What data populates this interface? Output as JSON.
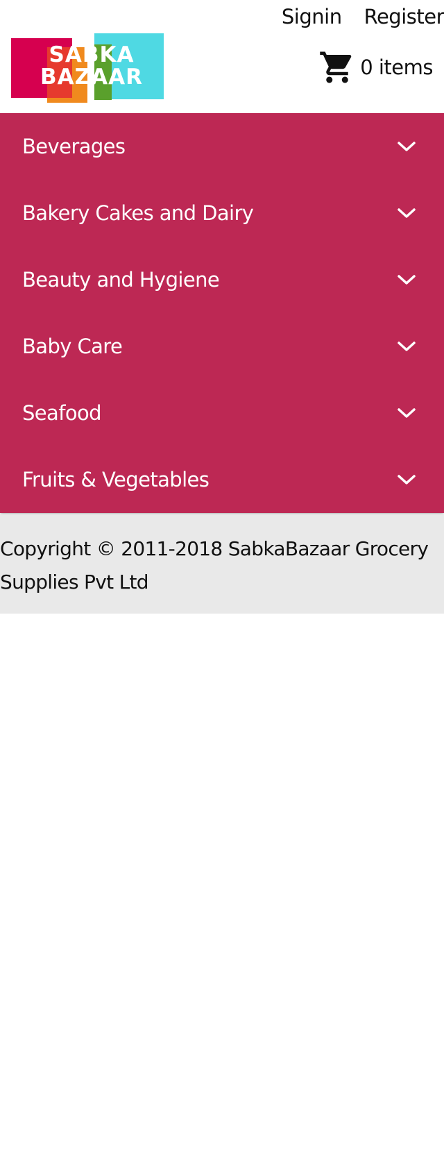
{
  "header": {
    "signin_label": "Signin",
    "register_label": "Register",
    "logo": {
      "line1": "SABKA",
      "line2": "BAZAAR",
      "colors": [
        "#d6004f",
        "#f08a1e",
        "#5aa02c",
        "#4fd9e3"
      ]
    },
    "cart": {
      "icon": "shopping-cart-icon",
      "count_text": "0 items"
    }
  },
  "menu": {
    "background": "#bd2854",
    "items": [
      {
        "label": "Beverages",
        "icon": "chevron-down-icon"
      },
      {
        "label": "Bakery Cakes and Dairy",
        "icon": "chevron-down-icon"
      },
      {
        "label": "Beauty and Hygiene",
        "icon": "chevron-down-icon"
      },
      {
        "label": "Baby Care",
        "icon": "chevron-down-icon"
      },
      {
        "label": "Seafood",
        "icon": "chevron-down-icon"
      },
      {
        "label": "Fruits & Vegetables",
        "icon": "chevron-down-icon"
      }
    ]
  },
  "footer": {
    "copyright": "Copyright © 2011-2018 SabkaBazaar Grocery Supplies Pvt Ltd"
  }
}
